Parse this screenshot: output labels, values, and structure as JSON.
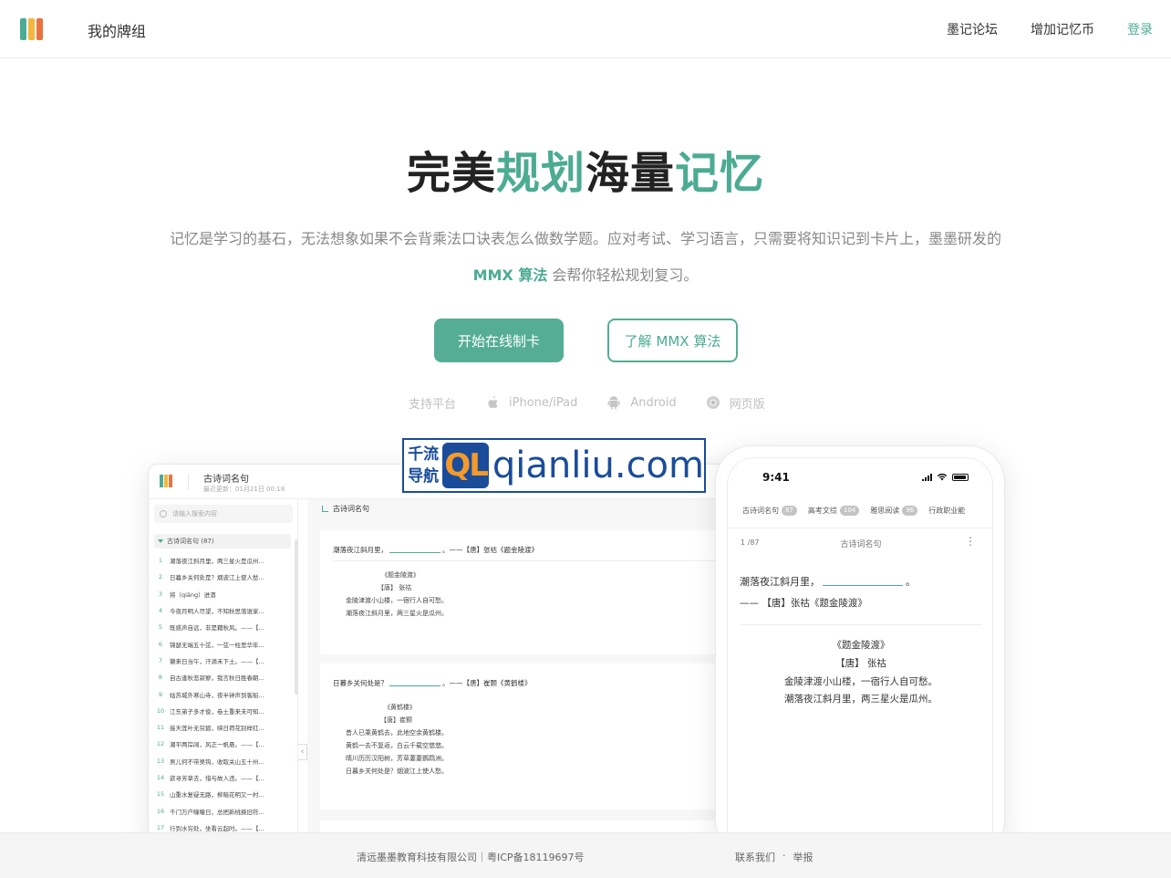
{
  "brand": {
    "name": "我的牌组",
    "logo_colors": [
      "#4cab93",
      "#f3b63f",
      "#e8733f"
    ]
  },
  "nav": {
    "forum": "墨记论坛",
    "coins": "增加记忆币",
    "login": "登录"
  },
  "hero": {
    "title_part1": "完美",
    "title_part2": "规划",
    "title_part3": "海量",
    "title_part4": "记忆",
    "desc_line1": "记忆是学习的基石，无法想象如果不会背乘法口诀表怎么做数学题。应对考试、学习语言，只需要将知识记到卡片上，墨墨研发的",
    "desc_mmx": "MMX 算法",
    "desc_line2_rest": " 会帮你轻松规划复习。",
    "accent": "#4cab93"
  },
  "buttons": {
    "start": "开始在线制卡",
    "learn": "了解 MMX 算法"
  },
  "platforms": {
    "label": "支持平台",
    "items": [
      {
        "icon": "apple-icon",
        "label": "iPhone/iPad"
      },
      {
        "icon": "android-icon",
        "label": "Android"
      },
      {
        "icon": "chrome-icon",
        "label": "网页版"
      }
    ]
  },
  "desktop": {
    "title": "古诗词名句",
    "updated": "最近更新：01月21日 00:18",
    "search_placeholder": "请输入搜索内容",
    "deck_header": "古诗词名句 (87)",
    "list": [
      {
        "n": "1",
        "text": "潮落夜江斜月里，两三星火是瓜州..."
      },
      {
        "n": "2",
        "text": "日暮乡关何处是？烟波江上使人愁..."
      },
      {
        "n": "3",
        "text": "将（qiāng）进酒"
      },
      {
        "n": "4",
        "text": "今夜月明人尽望，不知秋思落谁家..."
      },
      {
        "n": "5",
        "text": "既惑声自远，非是藉秋风。——【..."
      },
      {
        "n": "6",
        "text": "锦瑟无端五十弦，一弦一柱思华年..."
      },
      {
        "n": "7",
        "text": "獭来日当午，汗滴禾下土。——【..."
      },
      {
        "n": "8",
        "text": "自古逢秋悲寂寥，我言秋日胜春朝..."
      },
      {
        "n": "9",
        "text": "姑苏城外寒山寺，夜半钟声到客船..."
      },
      {
        "n": "10",
        "text": "江东弟子多才俊，卷土重来未可知..."
      },
      {
        "n": "11",
        "text": "接天莲叶无穷碧，映日荷花别样红..."
      },
      {
        "n": "12",
        "text": "潮平两岸阔，风正一帆悬。——【..."
      },
      {
        "n": "13",
        "text": "男儿何不带吴钩，收取关山五十州..."
      },
      {
        "n": "14",
        "text": "欲寻芳草去，惜与故人违。——【..."
      },
      {
        "n": "15",
        "text": "山重水复疑无路，柳暗花明又一村..."
      },
      {
        "n": "16",
        "text": "千门万户曈曈日，总把新桃换旧符..."
      },
      {
        "n": "17",
        "text": "行到水穷处，坐看云起时。——【..."
      }
    ],
    "main_header": "古诗词名句",
    "card1": {
      "q_pre": "潮落夜江斜月里，",
      "q_post": "。——【唐】张祜《题金陵渡》",
      "lines": [
        "《题金陵渡》",
        "【唐】  张祜",
        "金陵津渡小山楼，一宿行人自可愁。",
        "潮落夜江斜月里，两三星火是瓜州。"
      ]
    },
    "card2": {
      "q_pre": "日暮乡关何处是？",
      "q_post": "。——【唐】崔颢《黄鹤楼》",
      "lines": [
        "《黄鹤楼》",
        "【唐】崔颢",
        "昔人已乘黄鹤去，此地空余黄鹤楼。",
        "黄鹤一去不复返，白云千载空悠悠。",
        "晴川历历汉阳树，芳草萋萋鹦鹉洲。",
        "日暮乡关何处是？烟波江上使人愁。"
      ]
    }
  },
  "phone": {
    "time": "9:41",
    "tabs": [
      {
        "label": "古诗词名句",
        "count": "87"
      },
      {
        "label": "高考文综",
        "count": "104"
      },
      {
        "label": "雅思阅读",
        "count": "96"
      },
      {
        "label": "行政职业能",
        "count": ""
      }
    ],
    "progress": "1 /87",
    "deck": "古诗词名句",
    "more": "⋮",
    "q_pre": "潮落夜江斜月里，",
    "q_post": "。",
    "source": "—— 【唐】张祜《题金陵渡》",
    "lines": [
      "《题金陵渡》",
      "【唐】  张祜",
      "金陵津渡小山楼，一宿行人自可愁。",
      "潮落夜江斜月里，两三星火是瓜州。"
    ]
  },
  "watermark": {
    "left_top": "千流",
    "left_bottom": "导航",
    "ql": "QL",
    "domain": "qianliu.com"
  },
  "footer": {
    "company": "清远墨墨教育科技有限公司｜粤ICP备18119697号",
    "contact": "联系我们",
    "dot": "·",
    "report": "举报"
  }
}
